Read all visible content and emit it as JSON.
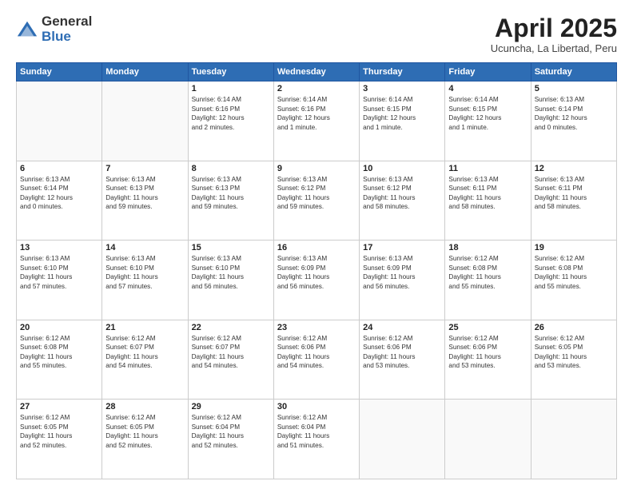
{
  "header": {
    "logo_general": "General",
    "logo_blue": "Blue",
    "month_year": "April 2025",
    "location": "Ucuncha, La Libertad, Peru"
  },
  "weekdays": [
    "Sunday",
    "Monday",
    "Tuesday",
    "Wednesday",
    "Thursday",
    "Friday",
    "Saturday"
  ],
  "weeks": [
    [
      {
        "day": "",
        "text": ""
      },
      {
        "day": "",
        "text": ""
      },
      {
        "day": "1",
        "text": "Sunrise: 6:14 AM\nSunset: 6:16 PM\nDaylight: 12 hours\nand 2 minutes."
      },
      {
        "day": "2",
        "text": "Sunrise: 6:14 AM\nSunset: 6:16 PM\nDaylight: 12 hours\nand 1 minute."
      },
      {
        "day": "3",
        "text": "Sunrise: 6:14 AM\nSunset: 6:15 PM\nDaylight: 12 hours\nand 1 minute."
      },
      {
        "day": "4",
        "text": "Sunrise: 6:14 AM\nSunset: 6:15 PM\nDaylight: 12 hours\nand 1 minute."
      },
      {
        "day": "5",
        "text": "Sunrise: 6:13 AM\nSunset: 6:14 PM\nDaylight: 12 hours\nand 0 minutes."
      }
    ],
    [
      {
        "day": "6",
        "text": "Sunrise: 6:13 AM\nSunset: 6:14 PM\nDaylight: 12 hours\nand 0 minutes."
      },
      {
        "day": "7",
        "text": "Sunrise: 6:13 AM\nSunset: 6:13 PM\nDaylight: 11 hours\nand 59 minutes."
      },
      {
        "day": "8",
        "text": "Sunrise: 6:13 AM\nSunset: 6:13 PM\nDaylight: 11 hours\nand 59 minutes."
      },
      {
        "day": "9",
        "text": "Sunrise: 6:13 AM\nSunset: 6:12 PM\nDaylight: 11 hours\nand 59 minutes."
      },
      {
        "day": "10",
        "text": "Sunrise: 6:13 AM\nSunset: 6:12 PM\nDaylight: 11 hours\nand 58 minutes."
      },
      {
        "day": "11",
        "text": "Sunrise: 6:13 AM\nSunset: 6:11 PM\nDaylight: 11 hours\nand 58 minutes."
      },
      {
        "day": "12",
        "text": "Sunrise: 6:13 AM\nSunset: 6:11 PM\nDaylight: 11 hours\nand 58 minutes."
      }
    ],
    [
      {
        "day": "13",
        "text": "Sunrise: 6:13 AM\nSunset: 6:10 PM\nDaylight: 11 hours\nand 57 minutes."
      },
      {
        "day": "14",
        "text": "Sunrise: 6:13 AM\nSunset: 6:10 PM\nDaylight: 11 hours\nand 57 minutes."
      },
      {
        "day": "15",
        "text": "Sunrise: 6:13 AM\nSunset: 6:10 PM\nDaylight: 11 hours\nand 56 minutes."
      },
      {
        "day": "16",
        "text": "Sunrise: 6:13 AM\nSunset: 6:09 PM\nDaylight: 11 hours\nand 56 minutes."
      },
      {
        "day": "17",
        "text": "Sunrise: 6:13 AM\nSunset: 6:09 PM\nDaylight: 11 hours\nand 56 minutes."
      },
      {
        "day": "18",
        "text": "Sunrise: 6:12 AM\nSunset: 6:08 PM\nDaylight: 11 hours\nand 55 minutes."
      },
      {
        "day": "19",
        "text": "Sunrise: 6:12 AM\nSunset: 6:08 PM\nDaylight: 11 hours\nand 55 minutes."
      }
    ],
    [
      {
        "day": "20",
        "text": "Sunrise: 6:12 AM\nSunset: 6:08 PM\nDaylight: 11 hours\nand 55 minutes."
      },
      {
        "day": "21",
        "text": "Sunrise: 6:12 AM\nSunset: 6:07 PM\nDaylight: 11 hours\nand 54 minutes."
      },
      {
        "day": "22",
        "text": "Sunrise: 6:12 AM\nSunset: 6:07 PM\nDaylight: 11 hours\nand 54 minutes."
      },
      {
        "day": "23",
        "text": "Sunrise: 6:12 AM\nSunset: 6:06 PM\nDaylight: 11 hours\nand 54 minutes."
      },
      {
        "day": "24",
        "text": "Sunrise: 6:12 AM\nSunset: 6:06 PM\nDaylight: 11 hours\nand 53 minutes."
      },
      {
        "day": "25",
        "text": "Sunrise: 6:12 AM\nSunset: 6:06 PM\nDaylight: 11 hours\nand 53 minutes."
      },
      {
        "day": "26",
        "text": "Sunrise: 6:12 AM\nSunset: 6:05 PM\nDaylight: 11 hours\nand 53 minutes."
      }
    ],
    [
      {
        "day": "27",
        "text": "Sunrise: 6:12 AM\nSunset: 6:05 PM\nDaylight: 11 hours\nand 52 minutes."
      },
      {
        "day": "28",
        "text": "Sunrise: 6:12 AM\nSunset: 6:05 PM\nDaylight: 11 hours\nand 52 minutes."
      },
      {
        "day": "29",
        "text": "Sunrise: 6:12 AM\nSunset: 6:04 PM\nDaylight: 11 hours\nand 52 minutes."
      },
      {
        "day": "30",
        "text": "Sunrise: 6:12 AM\nSunset: 6:04 PM\nDaylight: 11 hours\nand 51 minutes."
      },
      {
        "day": "",
        "text": ""
      },
      {
        "day": "",
        "text": ""
      },
      {
        "day": "",
        "text": ""
      }
    ]
  ]
}
